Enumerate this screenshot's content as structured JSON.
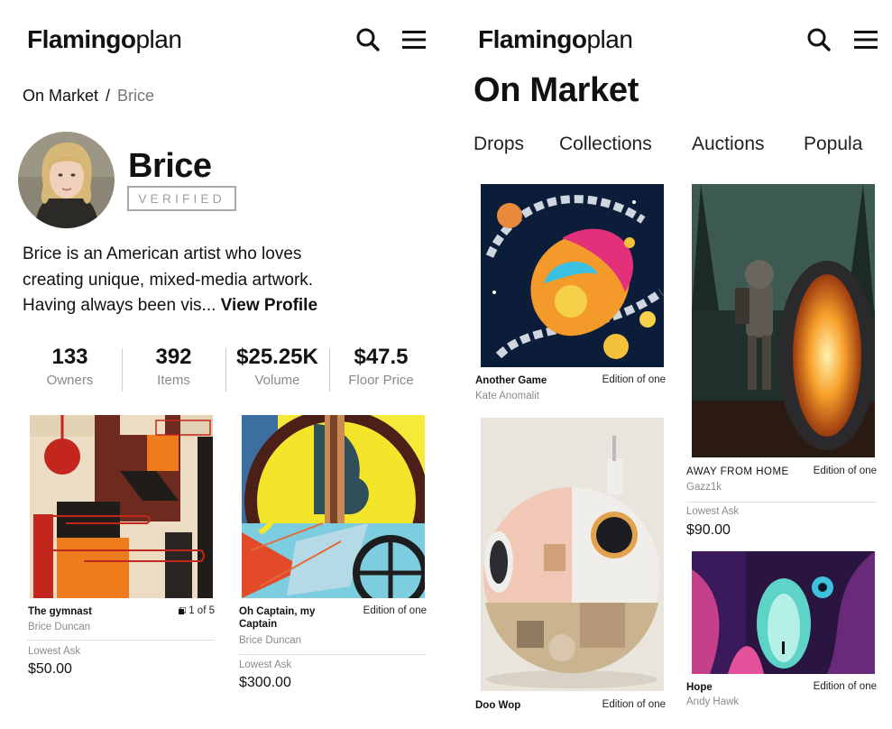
{
  "left": {
    "logo": {
      "bold": "Flamingo",
      "light": "plan"
    },
    "breadcrumb": {
      "root": "On Market",
      "sep": "/",
      "current": "Brice"
    },
    "artist": {
      "name": "Brice",
      "badge": "VERIFIED",
      "bio": "Brice  is an American artist who loves creating unique, mixed-media artwork. Having always been vis...",
      "bio_link": "View Profile"
    },
    "stats": [
      {
        "value": "133",
        "label": "Owners"
      },
      {
        "value": "392",
        "label": "Items"
      },
      {
        "value": "$25.25K",
        "label": "Volume"
      },
      {
        "value": "$47.5",
        "label": "Floor Price"
      }
    ],
    "cards": [
      {
        "title": "The gymnast",
        "edition": "1 of 5",
        "artist": "Brice Duncan",
        "ask_label": "Lowest Ask",
        "ask_value": "$50.00"
      },
      {
        "title": "Oh Captain, my Captain",
        "edition": "Edition of one",
        "artist": "Brice Duncan",
        "ask_label": "Lowest Ask",
        "ask_value": "$300.00"
      }
    ]
  },
  "right": {
    "logo": {
      "bold": "Flamingo",
      "light": "plan"
    },
    "page_title": "On Market",
    "tabs": [
      "Drops",
      "Collections",
      "Auctions",
      "Popula"
    ],
    "cards": [
      {
        "title": "Another Game",
        "edition": "Edition of one",
        "artist": "Kate Anomalit"
      },
      {
        "title": "Doo Wop",
        "edition": "Edition of one"
      },
      {
        "title": "AWAY FROM HOME",
        "edition": "Edition of one",
        "artist": "Gazz1k",
        "ask_label": "Lowest Ask",
        "ask_value": "$90.00"
      },
      {
        "title": "Hope",
        "edition": "Edition of one",
        "artist": "Andy Hawk"
      }
    ]
  },
  "icons": {
    "search": "search-icon",
    "menu": "menu-icon",
    "edition": "edition-icon"
  },
  "colors": {
    "text": "#111111",
    "muted": "#8a8a8a",
    "border": "#a9a9a9"
  }
}
